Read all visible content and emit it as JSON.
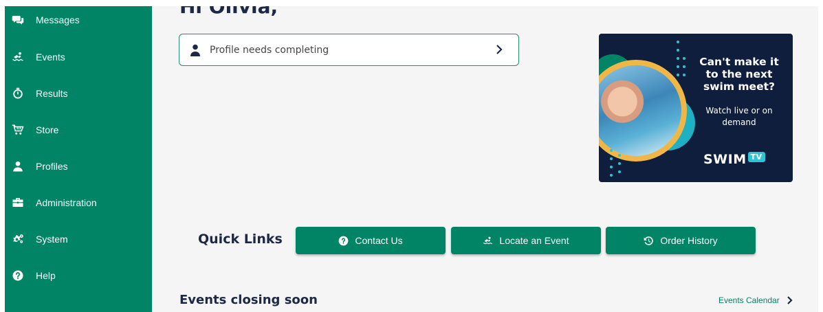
{
  "sidebar": {
    "items": [
      {
        "label": "Messages",
        "icon": "chat-bubbles-icon"
      },
      {
        "label": "Events",
        "icon": "swimmer-icon"
      },
      {
        "label": "Results",
        "icon": "stopwatch-icon"
      },
      {
        "label": "Store",
        "icon": "shopping-cart-icon"
      },
      {
        "label": "Profiles",
        "icon": "user-icon"
      },
      {
        "label": "Administration",
        "icon": "briefcase-icon"
      },
      {
        "label": "System",
        "icon": "gears-icon"
      },
      {
        "label": "Help",
        "icon": "question-circle-icon"
      }
    ]
  },
  "main": {
    "greeting": "Hi Olivia,",
    "profile_card": {
      "text": "Profile needs completing"
    },
    "ad": {
      "headline": "Can't make it to the next swim meet?",
      "subline": "Watch live or on demand",
      "brand": "SWIM",
      "brand_suffix": "TV"
    },
    "quick_links": {
      "label": "Quick Links",
      "buttons": [
        {
          "label": "Contact Us",
          "icon": "question-circle-icon"
        },
        {
          "label": "Locate an Event",
          "icon": "swimmer-icon"
        },
        {
          "label": "Order History",
          "icon": "history-icon"
        }
      ]
    },
    "events_closing": {
      "title": "Events closing soon",
      "calendar_link": "Events Calendar"
    }
  },
  "colors": {
    "brand_green": "#008466",
    "navy": "#1c2845",
    "background": "#f5f5f5"
  }
}
